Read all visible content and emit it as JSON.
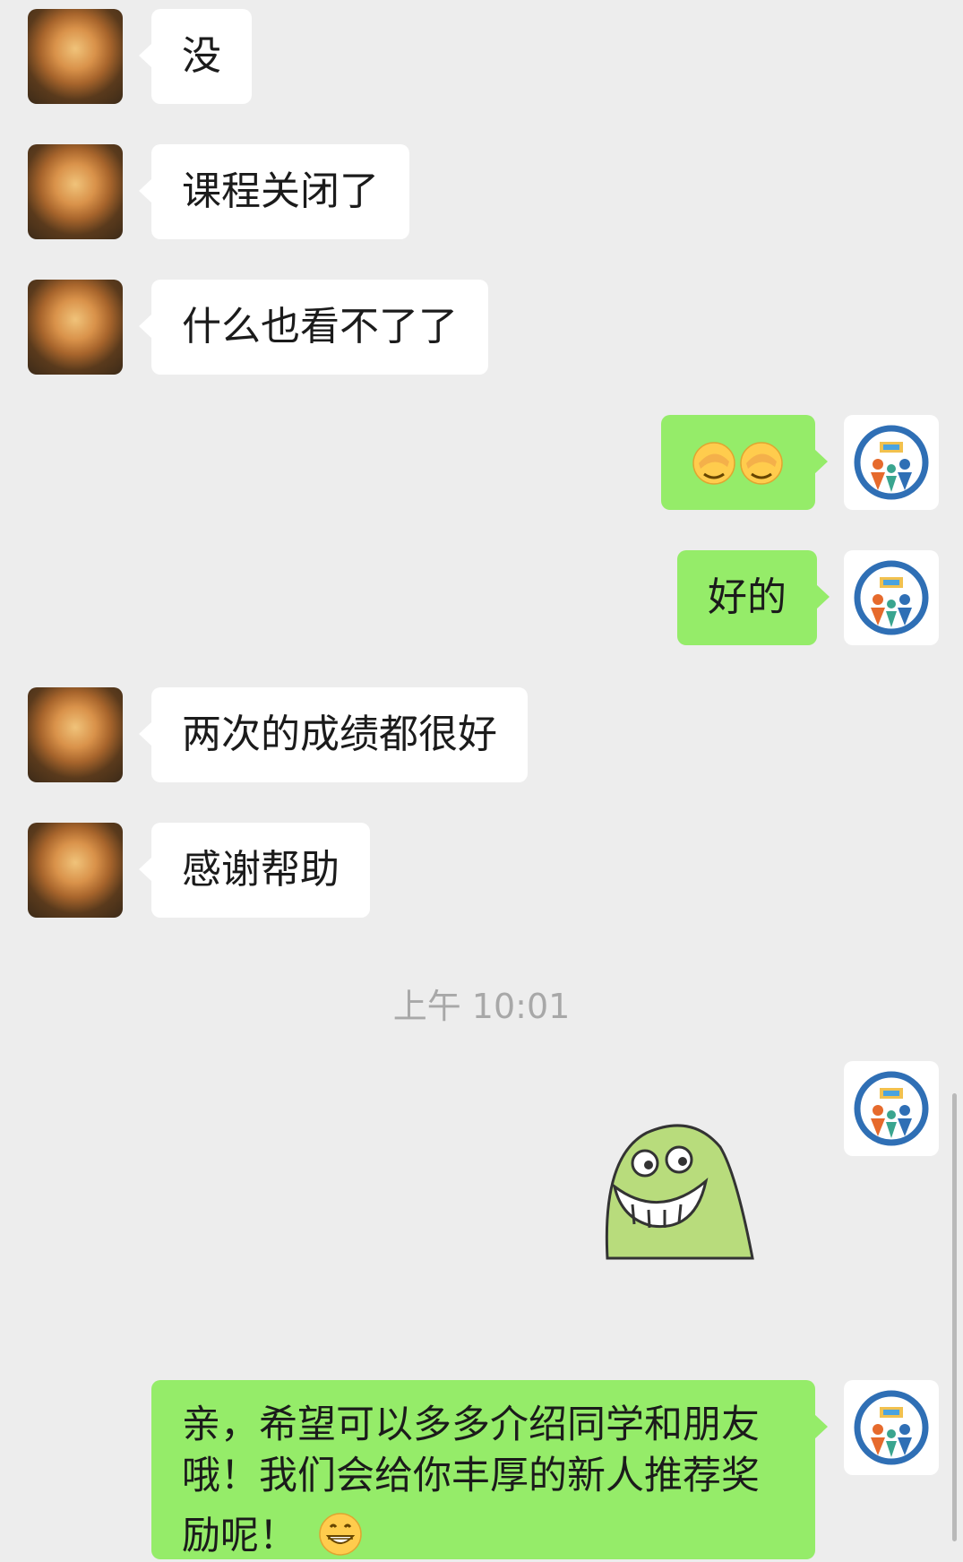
{
  "messages": [
    {
      "side": "left",
      "text": "没"
    },
    {
      "side": "left",
      "text": "课程关闭了"
    },
    {
      "side": "left",
      "text": "什么也看不了了"
    },
    {
      "side": "right",
      "emoji": [
        "face-palm-emoji",
        "face-palm-emoji"
      ]
    },
    {
      "side": "right",
      "text": "好的"
    },
    {
      "side": "left",
      "text": "两次的成绩都很好"
    },
    {
      "side": "left",
      "text": "感谢帮助"
    },
    {
      "side": "right",
      "sticker": "green-smiling-blob-sticker"
    },
    {
      "side": "right",
      "text": "亲，希望可以多多介绍同学和朋友哦！我们会给你丰厚的新人推荐奖励呢！",
      "lines": [
        "亲，希望可以多多介绍同学和朋友",
        "哦！我们会给你丰厚的新人推荐奖",
        "励呢！"
      ],
      "trailing_emoji": "grin-emoji"
    }
  ],
  "timestamp": "上午 10:01",
  "colors": {
    "background": "#ededed",
    "incoming_bubble": "#ffffff",
    "outgoing_bubble": "#95ec69",
    "timestamp": "#a8a8a8",
    "avatar_ring": "#2f6fb5"
  },
  "icons": {
    "left_avatar": "tiger-avatar",
    "right_avatar": "education-logo-avatar"
  }
}
